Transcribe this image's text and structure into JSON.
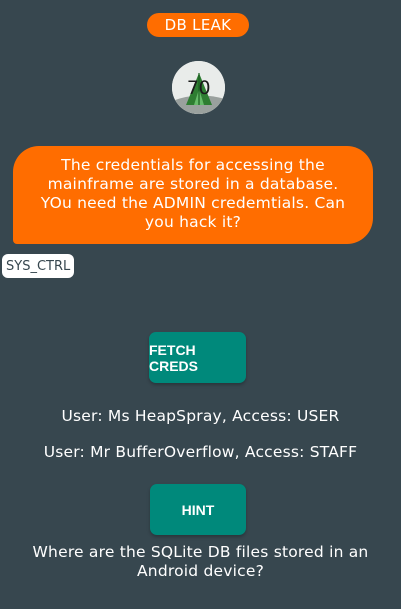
{
  "header": {
    "title": "DB LEAK"
  },
  "avatar": {
    "level": "70",
    "icon": "level-avatar-icon"
  },
  "message": {
    "text": "The credentials for accessing the mainframe are stored in a database. YOu need the ADMIN credemtials. Can you hack it?",
    "sender": "SYS_CTRL"
  },
  "actions": {
    "fetch_label": "FETCH CREDS",
    "hint_label": "HINT"
  },
  "results": [
    "User: Ms HeapSpray, Access: USER",
    "User: Mr BufferOverflow, Access: STAFF"
  ],
  "hint": {
    "text": "Where are the SQLite DB files stored in an Android device?"
  },
  "colors": {
    "background": "#37474f",
    "accent": "#ff6d00",
    "button": "#00897b",
    "text": "#ffffff"
  }
}
